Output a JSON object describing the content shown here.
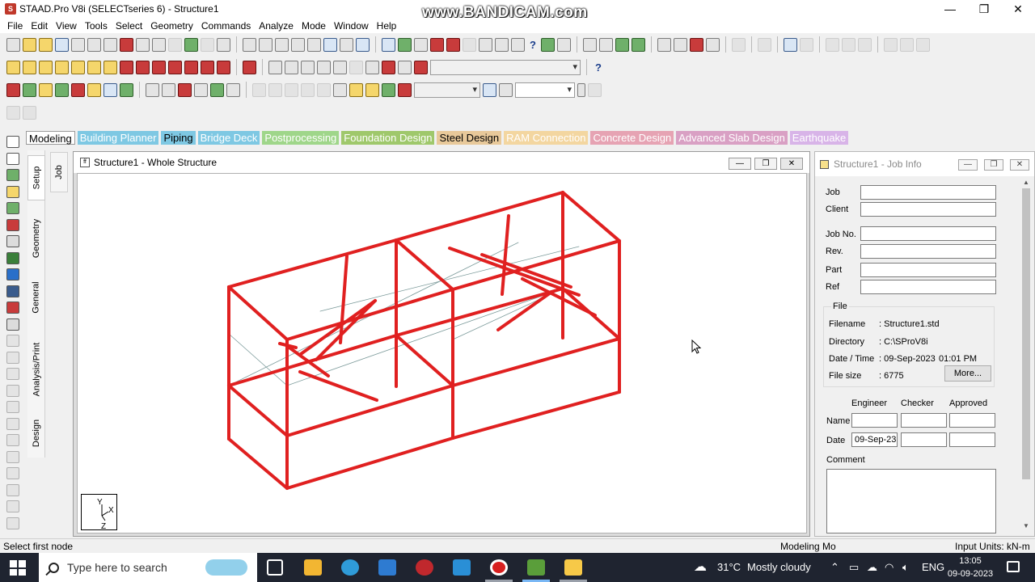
{
  "window": {
    "title": "STAAD.Pro V8i (SELECTseries 6) - Structure1",
    "watermark": "www.BANDICAM.com"
  },
  "menu": [
    "File",
    "Edit",
    "View",
    "Tools",
    "Select",
    "Geometry",
    "Commands",
    "Analyze",
    "Mode",
    "Window",
    "Help"
  ],
  "page_tabs": [
    {
      "label": "Modeling",
      "color": "#ffffff",
      "text": "#000000"
    },
    {
      "label": "Building Planner",
      "color": "#7ec8e3",
      "text": "#ffffff"
    },
    {
      "label": "Piping",
      "color": "#7ec8e3",
      "text": "#000000"
    },
    {
      "label": "Bridge Deck",
      "color": "#7ec8e3",
      "text": "#ffffff"
    },
    {
      "label": "Postprocessing",
      "color": "#9fd68a",
      "text": "#ffffff"
    },
    {
      "label": "Foundation Design",
      "color": "#9fc86b",
      "text": "#ffffff"
    },
    {
      "label": "Steel Design",
      "color": "#e8c99a",
      "text": "#000000"
    },
    {
      "label": "RAM Connection",
      "color": "#f3d6a0",
      "text": "#ffffff"
    },
    {
      "label": "Concrete Design",
      "color": "#e6a3b3",
      "text": "#ffffff"
    },
    {
      "label": "Advanced Slab Design",
      "color": "#d9a0c4",
      "text": "#ffffff"
    },
    {
      "label": "Earthquake",
      "color": "#d8b4e8",
      "text": "#ffffff"
    }
  ],
  "side_tabs": [
    "Setup",
    "Geometry",
    "General",
    "Analysis/Print",
    "Design"
  ],
  "job_tab": "Job",
  "viewport": {
    "title": "Structure1 - Whole Structure",
    "axis": {
      "y": "Y",
      "x": "X",
      "z": "Z"
    },
    "frame_color": "#e02020"
  },
  "job_info": {
    "title": "Structure1 - Job Info",
    "fields": [
      {
        "label": "Job",
        "value": ""
      },
      {
        "label": "Client",
        "value": ""
      },
      {
        "label": "Job No.",
        "value": ""
      },
      {
        "label": "Rev.",
        "value": ""
      },
      {
        "label": "Part",
        "value": ""
      },
      {
        "label": "Ref",
        "value": ""
      }
    ],
    "file_group": "File",
    "file": {
      "filename_label": "Filename",
      "filename": ": Structure1.std",
      "directory_label": "Directory",
      "directory": ": C:\\SProV8i",
      "datetime_label": "Date / Time",
      "date": ": 09-Sep-2023",
      "time": "01:01 PM",
      "filesize_label": "File size",
      "filesize": ": 6775"
    },
    "more_button": "More...",
    "sign_headers": [
      "Engineer",
      "Checker",
      "Approved"
    ],
    "name_label": "Name",
    "date_label": "Date",
    "engineer_date": "09-Sep-23",
    "comment_label": "Comment"
  },
  "status": {
    "left": "Select first node",
    "mode": "Modeling Mo",
    "units": "Input Units:  kN-m"
  },
  "taskbar": {
    "search_placeholder": "Type here to search",
    "temperature": "31°C",
    "weather": "Mostly cloudy",
    "language": "ENG",
    "time": "13:05",
    "date": "09-09-2023"
  }
}
